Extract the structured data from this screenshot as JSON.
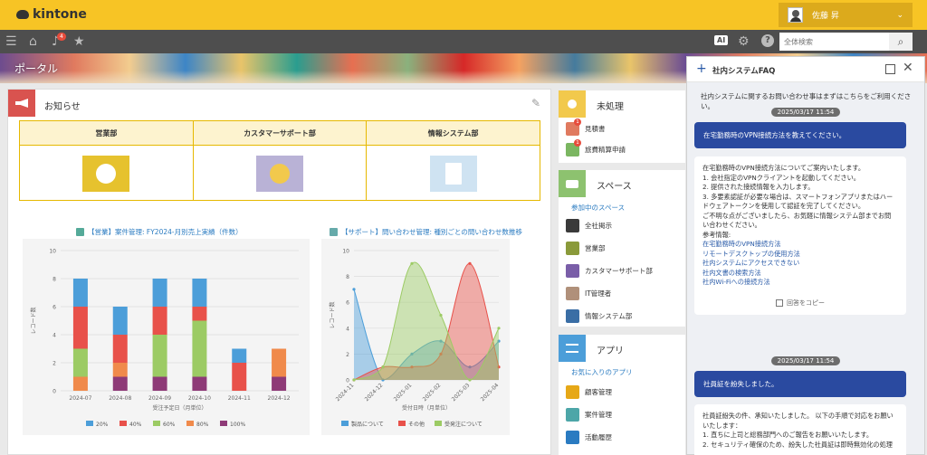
{
  "app": {
    "logo_text": "kintone"
  },
  "user": {
    "name": "佐藤 昇"
  },
  "toolbar": {
    "notification_count": "4",
    "ai_label": "AI",
    "search_placeholder": "全体検索"
  },
  "banner": {
    "title": "ポータル"
  },
  "notice": {
    "title": "お知らせ",
    "departments": [
      {
        "name": "営業部",
        "tile_color": "#e6c22e"
      },
      {
        "name": "カスタマーサポート部",
        "tile_color": "#b9b2d6"
      },
      {
        "name": "情報システム部",
        "tile_color": "#cfe3f2"
      }
    ]
  },
  "chart_left_title": "【営業】案件管理: FY2024-月別売上実績（件数）",
  "chart_right_title": "【サポート】問い合わせ管理: 種別ごとの問い合わせ数推移",
  "chart_data": [
    {
      "type": "bar",
      "stacked": true,
      "title": "【営業】案件管理: FY2024-月別売上実績（件数）",
      "xlabel": "受注予定日（月単位）",
      "ylabel": "レコード数",
      "ylim": [
        0,
        10
      ],
      "yticks": [
        "0",
        "2",
        "4",
        "6",
        "8",
        "10"
      ],
      "categories": [
        "2024-07",
        "2024-08",
        "2024-09",
        "2024-10",
        "2024-11",
        "2024-12"
      ],
      "series": [
        {
          "name": "100%",
          "color": "#8e3a77",
          "values": [
            0,
            1,
            1,
            1,
            0,
            1
          ]
        },
        {
          "name": "80%",
          "color": "#f08a4b",
          "values": [
            1,
            1,
            0,
            0,
            0,
            2
          ]
        },
        {
          "name": "60%",
          "color": "#9ccb64",
          "values": [
            2,
            0,
            3,
            4,
            0,
            0
          ]
        },
        {
          "name": "40%",
          "color": "#e8514a",
          "values": [
            3,
            2,
            2,
            1,
            2,
            0
          ]
        },
        {
          "name": "20%",
          "color": "#4c9ed9",
          "values": [
            2,
            2,
            2,
            2,
            1,
            0
          ]
        }
      ],
      "legend_order": [
        "20%",
        "40%",
        "60%",
        "80%",
        "100%"
      ],
      "legend_position": "bottom"
    },
    {
      "type": "area",
      "smooth": true,
      "title": "【サポート】問い合わせ管理: 種別ごとの問い合わせ数推移",
      "xlabel": "受付日時（月単位）",
      "ylabel": "レコード数",
      "ylim": [
        0,
        10
      ],
      "yticks": [
        "0",
        "2",
        "4",
        "6",
        "8",
        "10"
      ],
      "categories": [
        "2024-11",
        "2024-12",
        "2025-01",
        "2025-02",
        "2025-03",
        "2025-04"
      ],
      "series": [
        {
          "name": "製品について",
          "color": "#4c9ed9",
          "values": [
            7,
            0,
            2,
            3,
            1,
            3
          ]
        },
        {
          "name": "その他",
          "color": "#e8514a",
          "values": [
            0,
            1,
            1,
            2,
            9,
            1
          ]
        },
        {
          "name": "受発注について",
          "color": "#9ccb64",
          "values": [
            0,
            1,
            9,
            5,
            0,
            4
          ]
        }
      ],
      "legend_position": "bottom"
    }
  ],
  "sidebar": {
    "pending": {
      "title": "未処理",
      "items": [
        {
          "label": "見積書",
          "badge": "1",
          "color": "#e07a5f"
        },
        {
          "label": "旅費精算申請",
          "badge": "1",
          "color": "#7bb661"
        }
      ]
    },
    "space": {
      "title": "スペース",
      "subheading": "参加中のスペース",
      "items": [
        {
          "label": "全社掲示",
          "color": "#3a3a3a"
        },
        {
          "label": "営業部",
          "color": "#8a9a3a"
        },
        {
          "label": "カスタマーサポート部",
          "color": "#7a5ea8"
        },
        {
          "label": "IT管理者",
          "color": "#b0907a"
        },
        {
          "label": "情報システム部",
          "color": "#3a6ea5"
        }
      ]
    },
    "apps": {
      "title": "アプリ",
      "subheading": "お気に入りのアプリ",
      "items": [
        {
          "label": "顧客管理",
          "color": "#e6a817"
        },
        {
          "label": "案件管理",
          "color": "#4da6a8"
        },
        {
          "label": "活動履歴",
          "color": "#2a7bc1"
        }
      ]
    }
  },
  "faq": {
    "title": "社内システムFAQ",
    "intro": "社内システムに関するお問い合わせ事はまずはこちらをご利用ください。",
    "date1": "2025/03/17 11:54",
    "user_msg1": "在宅勤務時のVPN接続方法を教えてください。",
    "bot_msg1": {
      "lines": [
        "在宅勤務時のVPN接続方法についてご案内いたします。",
        "",
        "1. 会社指定のVPNクライアントを起動してください。",
        "2. 提供された接続情報を入力します。",
        "3. 多要素認証が必要な場合は、スマートフォンアプリまたはハー",
        "ドウェアトークンを使用して認証を完了してください。",
        "",
        "ご不明な点がございましたら、お気軽に情報システム部までお問",
        "い合わせください。",
        "",
        "参考情報:"
      ],
      "links": [
        "在宅勤務時のVPN接続方法",
        "リモートデスクトップの使用方法",
        "社内システムにアクセスできない",
        "社内文書の検索方法",
        "社内Wi-Fiへの接続方法"
      ],
      "copy_label": "回答をコピー"
    },
    "date2": "2025/03/17 11:54",
    "user_msg2": "社員証を紛失しました。",
    "bot_msg2": {
      "lines": [
        "社員証紛失の件、承知いたしました。 以下の手順で対応をお願い",
        "いたします：",
        "",
        "1. 直ちに上司と総務部門へのご報告をお願いいたします。",
        "2. セキュリティ確保のため、紛失した社員証は即時無効化の処理"
      ]
    }
  }
}
